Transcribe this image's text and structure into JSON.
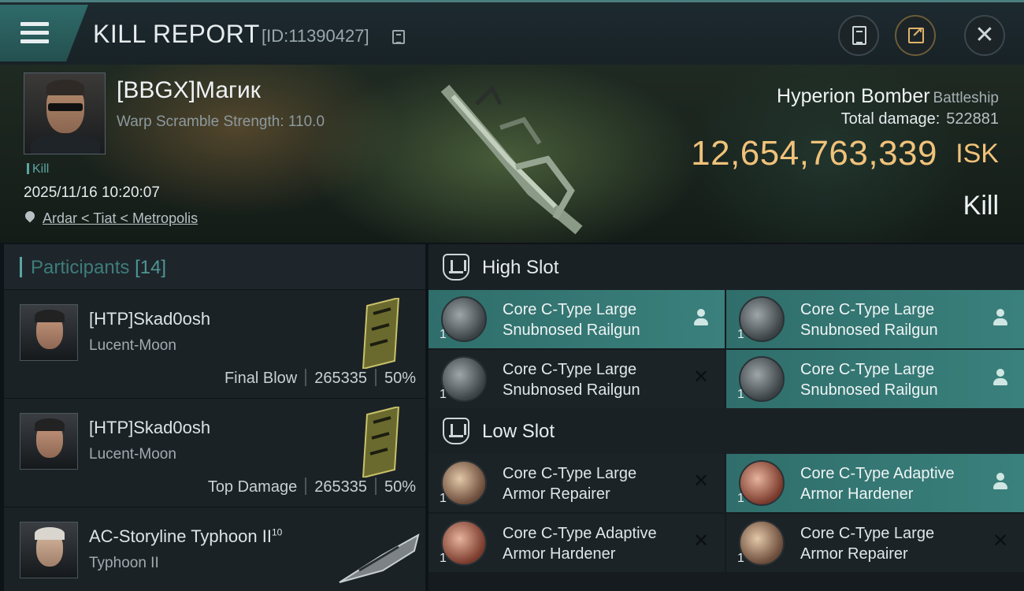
{
  "header": {
    "title": "KILL REPORT",
    "report_id": "[ID:11390427]"
  },
  "victim": {
    "name": "[BBGX]Магик",
    "subtitle": "Warp Scramble Strength: 110.0",
    "tag": "Kill",
    "datetime": "2025/11/16 10:20:07",
    "location": "Ardar < Tiat < Metropolis"
  },
  "ship": {
    "name": "Hyperion Bomber",
    "class": "Battleship",
    "total_damage_label": "Total damage:",
    "total_damage": "522881",
    "isk_value": "12,654,763,339",
    "isk_label": "ISK",
    "result": "Kill"
  },
  "participants": {
    "title": "Participants",
    "count": "[14]",
    "items": [
      {
        "name": "[HTP]Skad0osh",
        "ship": "Lucent-Moon",
        "role": "Final Blow",
        "damage": "265335",
        "percent": "50%"
      },
      {
        "name": "[HTP]Skad0osh",
        "ship": "Lucent-Moon",
        "role": "Top Damage",
        "damage": "265335",
        "percent": "50%"
      },
      {
        "name": "AC-Storyline Typhoon II",
        "level": "10",
        "ship": "Typhoon II"
      }
    ]
  },
  "high_slot": {
    "title": "High Slot",
    "modules": [
      {
        "qty": "1",
        "line1": "Core C-Type Large",
        "line2": "Snubnosed Railgun",
        "status": "dropped"
      },
      {
        "qty": "1",
        "line1": "Core C-Type Large",
        "line2": "Snubnosed Railgun",
        "status": "dropped"
      },
      {
        "qty": "1",
        "line1": "Core C-Type Large",
        "line2": "Snubnosed Railgun",
        "status": "destroyed"
      },
      {
        "qty": "1",
        "line1": "Core C-Type Large",
        "line2": "Snubnosed Railgun",
        "status": "dropped"
      }
    ]
  },
  "low_slot": {
    "title": "Low Slot",
    "modules": [
      {
        "qty": "1",
        "line1": "Core C-Type Large",
        "line2": "Armor Repairer",
        "status": "destroyed"
      },
      {
        "qty": "1",
        "line1": "Core C-Type Adaptive",
        "line2": "Armor Hardener",
        "status": "dropped"
      },
      {
        "qty": "1",
        "line1": "Core C-Type Adaptive",
        "line2": "Armor Hardener",
        "status": "destroyed"
      },
      {
        "qty": "1",
        "line1": "Core C-Type Large",
        "line2": "Armor Repairer",
        "status": "destroyed"
      }
    ]
  },
  "colors": {
    "accent_teal": "#5aa6a3",
    "fitted_bg": "#3a807c",
    "isk_gold": "#f0c27a"
  }
}
